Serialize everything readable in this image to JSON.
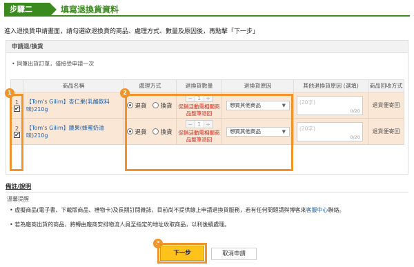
{
  "step": {
    "badge": "步驟二",
    "title": "填寫退換貨資料"
  },
  "instruction": "進入退換貨申請畫面，請勾選欲退換貨的商品、處理方式、數量及原因後，再點擊「下一步」",
  "panel": {
    "title": "申請退/換貨",
    "note": "•  同筆出貨訂單，僅接受申請一次"
  },
  "table": {
    "headers": [
      "商品名稱",
      "處理方式",
      "退換貨數量",
      "退換貨原因",
      "其他退換貨原因 (選填)",
      "商品回收方式"
    ],
    "rows": [
      {
        "num": "1",
        "checked": "✔",
        "name": "【Tom's Gilim】杏仁果(乳酪飲料味)210g",
        "option_return": "退貨",
        "option_exchange": "換貨",
        "qty": "1",
        "promo": "促銷活動需相關商品整筆退回",
        "reason": "想買其他商品",
        "other_placeholder": "(20字)",
        "counter": "0/20",
        "method": "退貨便寄回"
      },
      {
        "num": "2",
        "checked": "✔",
        "name": "【Tom's Gilim】腰果(蜂蜜奶油味)210g",
        "option_return": "退貨",
        "option_exchange": "換貨",
        "qty": "1",
        "promo": "促銷活動需相關商品整筆退回",
        "reason": "想買其他商品",
        "other_placeholder": "(20字)",
        "counter": "0/20",
        "method": "退貨便寄回"
      }
    ]
  },
  "callouts": [
    "1",
    "2",
    "3"
  ],
  "remarks": {
    "title": "備註/說明",
    "subtitle": "溫馨提醒",
    "line1_before": "•  虛擬商品(電子書、下載版商品、禮物卡)及長期訂閱雜誌，目前尚不提供線上申請退換貨服務，若有任何問題請與博客來",
    "line1_link": "客服中心",
    "line1_after": "聯絡。",
    "line2": "•  若為廠商出貨的商品，將轉由廠商安排物流人員至指定的地址收取商品，以利後續處理。"
  },
  "buttons": {
    "next": "下一步",
    "cancel": "取消申請"
  },
  "colors": {
    "step_green": "#3a8a1e",
    "highlight_orange": "#f0932b",
    "next_button": "#ffc21a",
    "row_bg": "#fbe7d6"
  }
}
